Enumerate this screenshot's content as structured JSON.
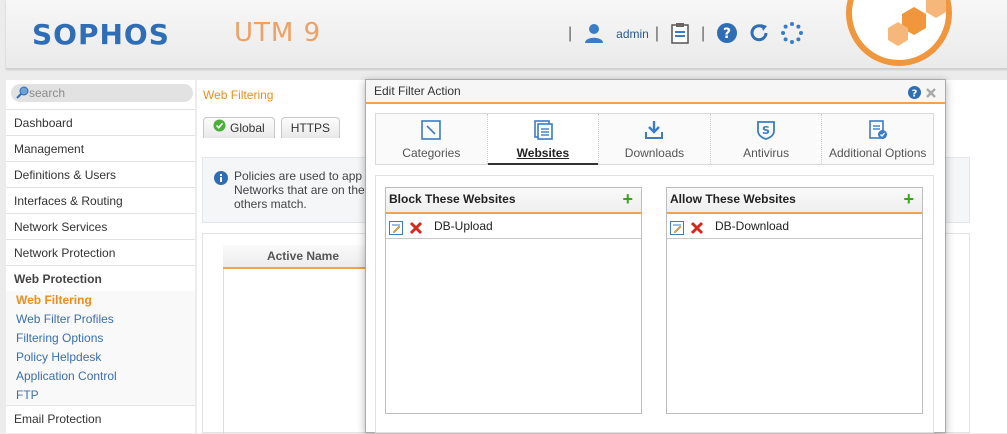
{
  "header": {
    "brand": "SOPHOS",
    "product": "UTM 9",
    "user": "admin"
  },
  "sidebar": {
    "search_placeholder": "search",
    "items": [
      {
        "label": "Dashboard"
      },
      {
        "label": "Management"
      },
      {
        "label": "Definitions & Users"
      },
      {
        "label": "Interfaces & Routing"
      },
      {
        "label": "Network Services"
      },
      {
        "label": "Network Protection"
      },
      {
        "label": "Web Protection"
      }
    ],
    "sub_items": [
      {
        "label": "Web Filtering"
      },
      {
        "label": "Web Filter Profiles"
      },
      {
        "label": "Filtering Options"
      },
      {
        "label": "Policy Helpdesk"
      },
      {
        "label": "Application Control"
      },
      {
        "label": "FTP"
      }
    ],
    "after": {
      "label": "Email Protection"
    }
  },
  "main": {
    "breadcrumb": "Web Filtering",
    "tabs": [
      {
        "label": "Global"
      },
      {
        "label": "HTTPS"
      }
    ],
    "info_line1": "Policies are used to app",
    "info_line2": "Networks that are on the",
    "info_line3": "others match.",
    "column_header": "Active Name"
  },
  "dialog": {
    "title": "Edit Filter Action",
    "tabs": [
      {
        "label": "Categories"
      },
      {
        "label": "Websites"
      },
      {
        "label": "Downloads"
      },
      {
        "label": "Antivirus"
      },
      {
        "label": "Additional Options"
      }
    ],
    "block": {
      "title": "Block These Websites",
      "items": [
        {
          "label": "DB-Upload"
        }
      ]
    },
    "allow": {
      "title": "Allow These Websites",
      "items": [
        {
          "label": "DB-Download"
        }
      ]
    }
  },
  "colors": {
    "brand_blue": "#2f6eb5",
    "accent_orange": "#f08c1e",
    "add_green": "#3ca41c",
    "delete_red": "#d42a1e"
  }
}
